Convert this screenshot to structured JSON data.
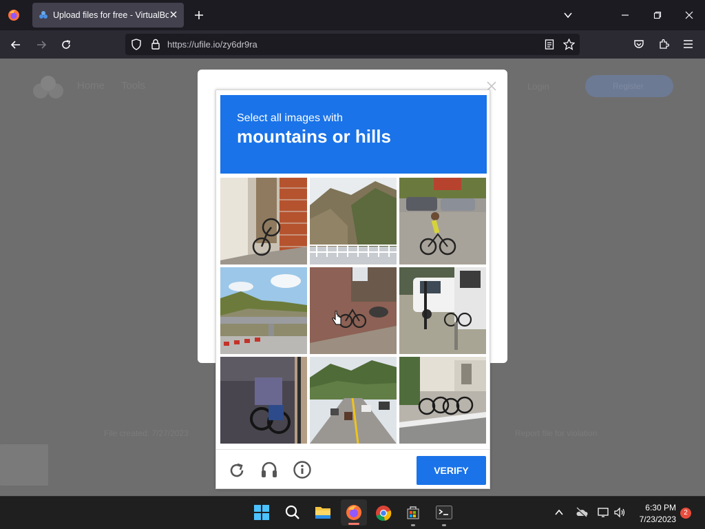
{
  "browser": {
    "tab_title": "Upload files for free - VirtualBox",
    "url": "https://ufile.io/zy6dr9ra"
  },
  "page": {
    "nav_home": "Home",
    "nav_tools": "Tools",
    "nav_login": "Login",
    "nav_register": "Register",
    "footer_file_created": "File created: 7/27/2023",
    "footer_report": "Report file for violation"
  },
  "captcha": {
    "instruction": "Select all images with",
    "target": "mountains or hills",
    "verify_label": "VERIFY",
    "tiles": [
      "bicycle-against-brick-wall",
      "mountain-with-bridge-railing",
      "cyclist-on-road",
      "hills-with-overpass",
      "bicycle-against-red-wall",
      "bicycle-by-parked-cars",
      "bicycles-in-dark-garage",
      "highway-with-motorcycles-and-hills",
      "bicycles-parked-on-sidewalk"
    ]
  },
  "taskbar": {
    "time": "6:30 PM",
    "date": "7/23/2023",
    "notification_count": "2"
  },
  "colors": {
    "captcha_blue": "#1a73e8",
    "chrome_dark": "#1c1b22",
    "overlay_gray": "#6e6e6e"
  }
}
